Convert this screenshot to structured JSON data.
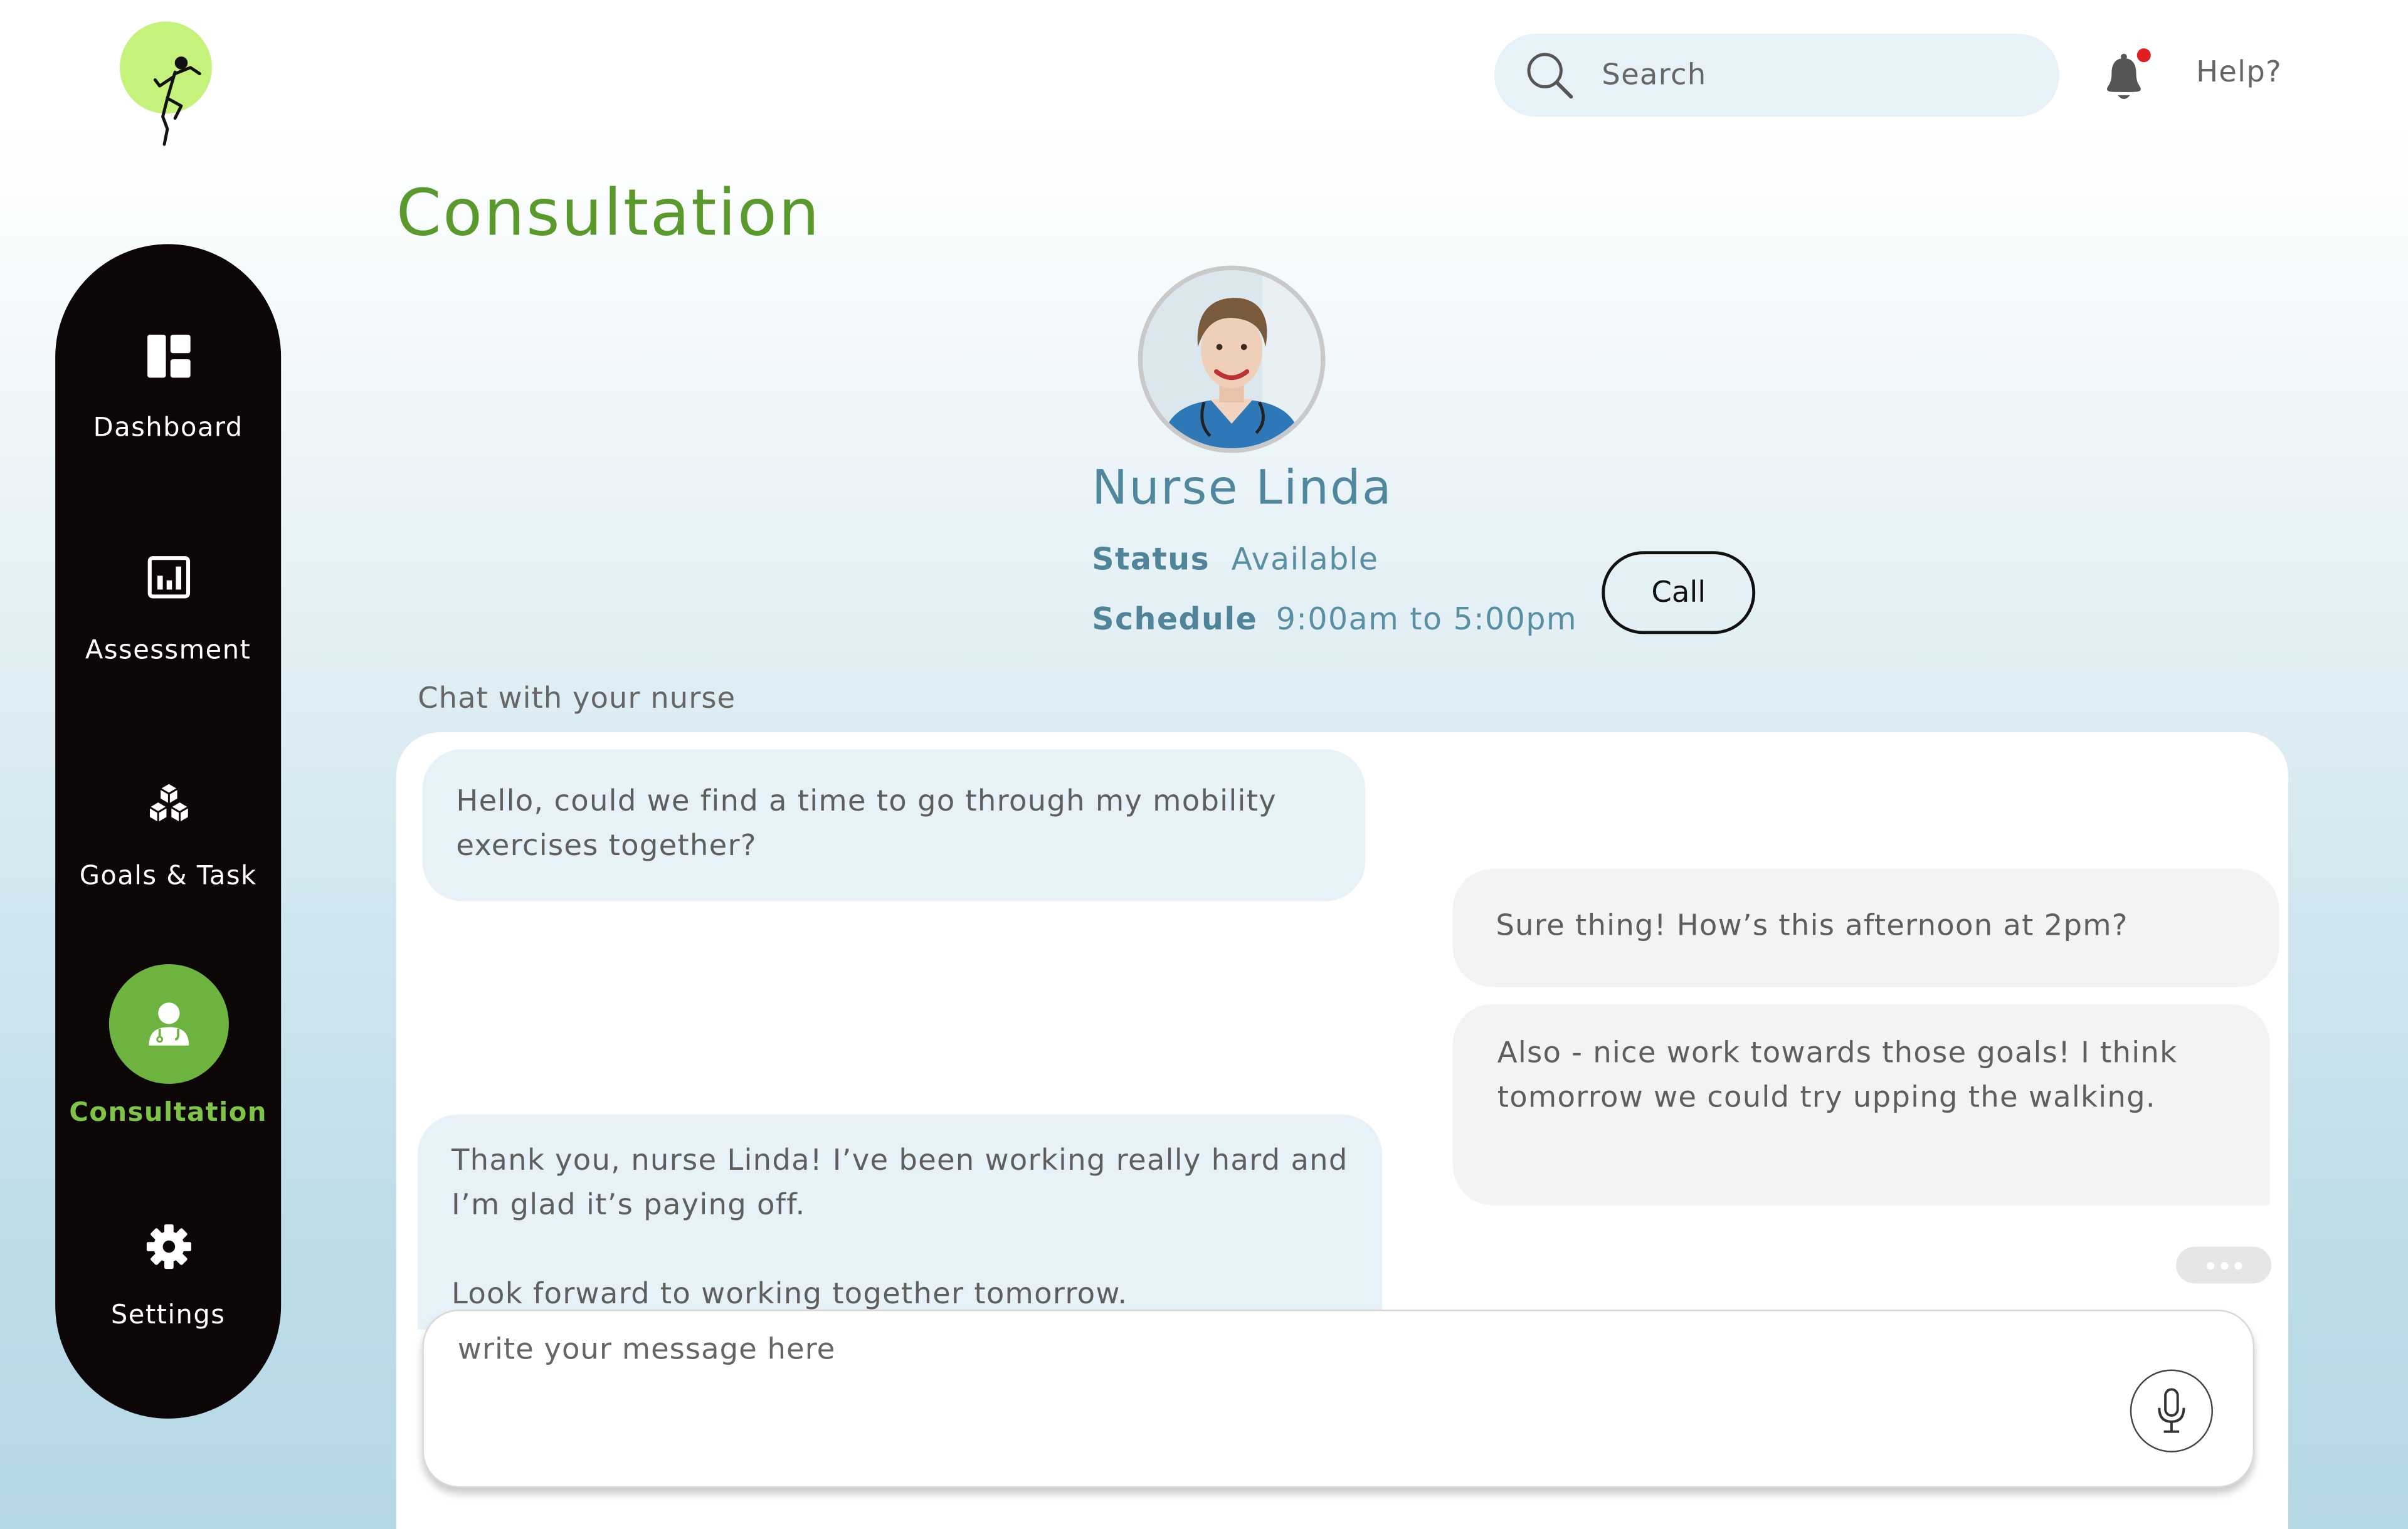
{
  "header": {
    "search_placeholder": "Search",
    "help_label": "Help?",
    "notification_dot_color": "#e02020"
  },
  "sidebar": {
    "items": [
      {
        "label": "Dashboard",
        "icon": "dashboard-icon"
      },
      {
        "label": "Assessment",
        "icon": "chart-icon"
      },
      {
        "label": "Goals & Task",
        "icon": "cubes-icon"
      },
      {
        "label": "Consultation",
        "icon": "doctor-icon",
        "active": true
      },
      {
        "label": "Settings",
        "icon": "gear-icon"
      }
    ],
    "active_color": "#6cb33f"
  },
  "page": {
    "title": "Consultation"
  },
  "nurse": {
    "name": "Nurse Linda",
    "status_label": "Status",
    "status_value": "Available",
    "schedule_label": "Schedule",
    "schedule_value": "9:00am to 5:00pm",
    "call_label": "Call"
  },
  "chat": {
    "label": "Chat with your nurse",
    "messages": [
      {
        "from": "user",
        "text": "Hello, could we find a time to go through my mobility exercises together?"
      },
      {
        "from": "nurse",
        "text": "Sure thing! How’s this afternoon at 2pm?"
      },
      {
        "from": "nurse",
        "text": "Also - nice work towards those goals! I think tomorrow we could try upping the walking."
      },
      {
        "from": "user",
        "text": "Thank you, nurse Linda! I’ve been working really hard and I’m glad it’s paying off.",
        "text2": "Look forward to working together tomorrow."
      }
    ],
    "composer_placeholder": "write your message here"
  }
}
